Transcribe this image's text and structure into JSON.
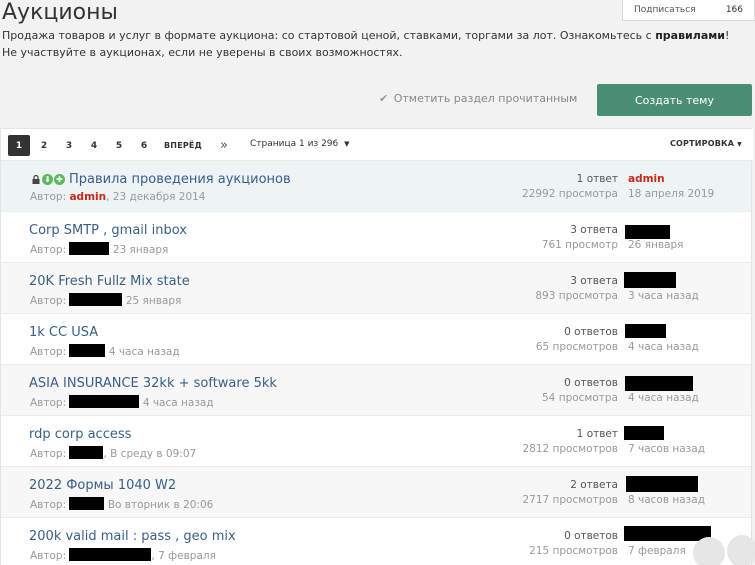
{
  "header": {
    "title": "Аукционы",
    "subscribe_label": "Подписаться",
    "subscribe_count": "166"
  },
  "description": {
    "line1_start": "Продажа товаров и услуг в формате аукциона: со стартовой ценой, ставками, торгами за лот. Ознакомьтесь с ",
    "line1_link": "правилами",
    "line1_end": "!",
    "line2": "Не участвуйте в аукционах, если не уверены в своих возможностях."
  },
  "actions": {
    "mark_read": "Отметить раздел прочитанным",
    "create_topic": "Создать тему"
  },
  "pagination": {
    "pages": [
      "1",
      "2",
      "3",
      "4",
      "5",
      "6"
    ],
    "active": "1",
    "next_label": "ВПЕРЁД",
    "last_label": "»",
    "page_info": "Страница 1 из 296",
    "sort_label": "СОРТИРОВКА"
  },
  "topics": [
    {
      "title": "Правила проведения аукционов",
      "author_prefix": "Автор:",
      "author": "admin",
      "date": ", 23 декабря 2014",
      "replies": "1 ответ",
      "views": "22992 просмотра",
      "last_user": "admin",
      "last_date": "18 апреля 2019"
    },
    {
      "title": "Corp SMTP , gmail inbox",
      "author_prefix": "Автор:",
      "date": "23 января",
      "replies": "3 ответа",
      "views": "761 просмотр",
      "last_date": "26 января"
    },
    {
      "title": "20K Fresh Fullz Mix state",
      "author_prefix": "Автор:",
      "date": "25 января",
      "replies": "3 ответа",
      "views": "893 просмотра",
      "last_date": "3 часа назад"
    },
    {
      "title": "1k CC USA",
      "author_prefix": "Автор:",
      "date": "4 часа назад",
      "replies": "0 ответов",
      "views": "65 просмотров",
      "last_date": "4 часа назад"
    },
    {
      "title": "ASIA INSURANCE 32kk + software 5kk",
      "author_prefix": "Автор:",
      "date": "4 часа назад",
      "replies": "0 ответов",
      "views": "54 просмотра",
      "last_date": "4 часа назад"
    },
    {
      "title": "rdp corp access",
      "author_prefix": "Автор:",
      "date": ", В среду в 09:07",
      "replies": "1 ответ",
      "views": "2812 просмотров",
      "last_date": "7 часов назад"
    },
    {
      "title": "2022 Формы 1040 W2",
      "author_prefix": "Автор:",
      "date": "Во вторник в 20:06",
      "replies": "2 ответа",
      "views": "2717 просмотров",
      "last_date": "8 часов назад"
    },
    {
      "title": "200k valid mail : pass , geo mix",
      "author_prefix": "Автор:",
      "date": ", 7 февраля",
      "replies": "0 ответов",
      "views": "215 просмотров",
      "last_date": "7 февраля"
    }
  ],
  "colors": {
    "accent_green": "#4a8f74",
    "link_blue": "#3a5f86",
    "admin_red": "#c8291d"
  }
}
